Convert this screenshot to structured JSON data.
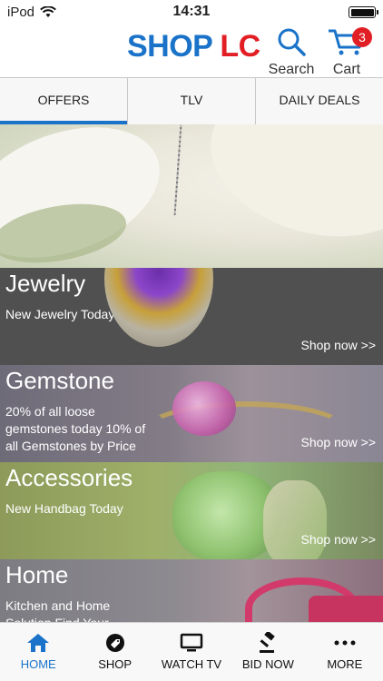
{
  "status_bar": {
    "carrier": "iPod",
    "time": "14:31",
    "icons": [
      "wifi-icon",
      "battery-icon"
    ]
  },
  "header": {
    "logo_shop": "SHOP",
    "logo_lc": "LC",
    "search_label": "Search",
    "cart_label": "Cart",
    "cart_count": "3",
    "brand_blue": "#1a73c9",
    "brand_red": "#e21e25"
  },
  "tabs": [
    {
      "label": "OFFERS",
      "active": true
    },
    {
      "label": "TLV",
      "active": false
    },
    {
      "label": "DAILY DEALS",
      "active": false
    }
  ],
  "sections": [
    {
      "title": "Jewelry",
      "description": "New Jewelry Today",
      "cta": "Shop now >>"
    },
    {
      "title": "Gemstone",
      "description": "20% of all loose gemstones today 10% of all Gemstones by Price",
      "cta": "Shop now >>"
    },
    {
      "title": "Accessories",
      "description": "New Handbag Today",
      "cta": "Shop now >>"
    },
    {
      "title": "Home",
      "description": "Kitchen and Home Solution Find Your",
      "cta": ""
    }
  ],
  "bottom_nav": [
    {
      "label": "HOME",
      "icon": "home-icon",
      "active": true
    },
    {
      "label": "SHOP",
      "icon": "tag-icon",
      "active": false
    },
    {
      "label": "WATCH TV",
      "icon": "tv-icon",
      "active": false
    },
    {
      "label": "BID NOW",
      "icon": "gavel-icon",
      "active": false
    },
    {
      "label": "MORE",
      "icon": "more-icon",
      "active": false
    }
  ]
}
